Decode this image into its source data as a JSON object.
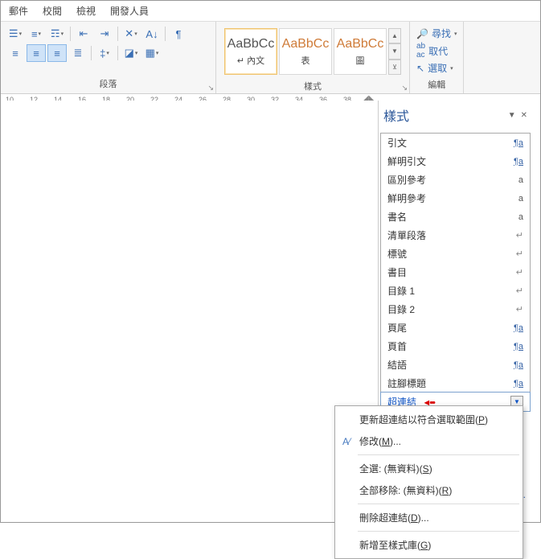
{
  "menubar": [
    "郵件",
    "校閱",
    "檢視",
    "開發人員"
  ],
  "ribbon": {
    "paragraph": {
      "label": "段落",
      "row1_icons": [
        "bullets",
        "numbering",
        "multilevel",
        "dec-indent",
        "inc-indent",
        "sort",
        "az-sort",
        "pilcrow"
      ],
      "row2_icons": [
        "align-left",
        "align-center",
        "align-right",
        "justify",
        "line-spacing",
        "shading",
        "borders"
      ]
    },
    "styles": {
      "label": "樣式",
      "tiles": [
        {
          "preview": "AaBbCc",
          "name": "↵ 內文",
          "orange": false,
          "selected": true
        },
        {
          "preview": "AaBbCc",
          "name": "表",
          "orange": true,
          "selected": false
        },
        {
          "preview": "AaBbCc",
          "name": "圖",
          "orange": true,
          "selected": false
        }
      ]
    },
    "editing": {
      "label": "編輯",
      "find": "尋找",
      "replace": "取代",
      "select": "選取"
    }
  },
  "ruler_ticks": [
    10,
    12,
    14,
    16,
    18,
    20,
    22,
    24,
    26,
    28,
    30,
    32,
    34,
    36,
    38
  ],
  "styles_pane": {
    "title": "樣式",
    "items": [
      {
        "name": "引文",
        "meta": "¶a",
        "meta_class": ""
      },
      {
        "name": "鮮明引文",
        "meta": "¶a",
        "meta_class": ""
      },
      {
        "name": "區別參考",
        "meta": "a",
        "meta_class": "plain"
      },
      {
        "name": "鮮明參考",
        "meta": "a",
        "meta_class": "plain"
      },
      {
        "name": "書名",
        "meta": "a",
        "meta_class": "plain"
      },
      {
        "name": "清單段落",
        "meta": "↵",
        "meta_class": "ret"
      },
      {
        "name": "標號",
        "meta": "↵",
        "meta_class": "ret"
      },
      {
        "name": "書目",
        "meta": "↵",
        "meta_class": "ret"
      },
      {
        "name": "目錄 1",
        "meta": "↵",
        "meta_class": "ret"
      },
      {
        "name": "目錄 2",
        "meta": "↵",
        "meta_class": "ret"
      },
      {
        "name": "頁尾",
        "meta": "¶a",
        "meta_class": ""
      },
      {
        "name": "頁首",
        "meta": "¶a",
        "meta_class": ""
      },
      {
        "name": "結語",
        "meta": "¶a",
        "meta_class": ""
      },
      {
        "name": "註腳標題",
        "meta": "¶a",
        "meta_class": ""
      }
    ],
    "selected": "超連結"
  },
  "context_menu": {
    "update": {
      "pre": "更新超連結以符合選取範圍(",
      "m": "P",
      "post": ")"
    },
    "modify": {
      "pre": "修改(",
      "m": "M",
      "post": ")..."
    },
    "select_all": {
      "pre": "全選: (無資料)(",
      "m": "S",
      "post": ")"
    },
    "remove_all": {
      "pre": "全部移除: (無資料)(",
      "m": "R",
      "post": ")"
    },
    "delete": {
      "pre": "刪除超連結(",
      "m": "D",
      "post": ")..."
    },
    "add_gallery": {
      "pre": "新增至樣式庫(",
      "m": "G",
      "post": ")"
    }
  },
  "options_link": "頁..."
}
